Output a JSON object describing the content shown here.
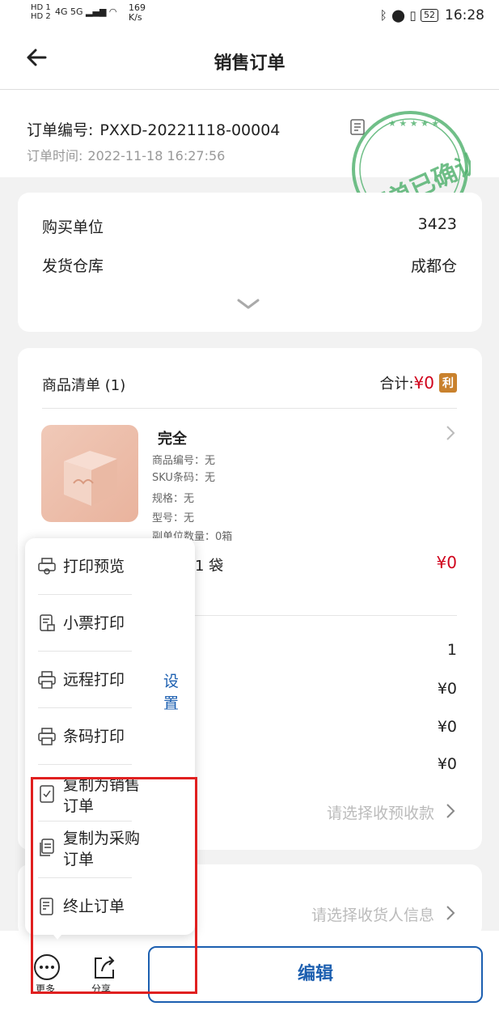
{
  "status_bar": {
    "hd1": "HD 1",
    "hd2": "HD 2",
    "signal": "4G 5G",
    "speed_value": "169",
    "speed_unit": "K/s",
    "battery": "52",
    "time": "16:28"
  },
  "header": {
    "title": "销售订单"
  },
  "order": {
    "number_label": "订单编号:",
    "number": "PXXD-20221118-00004",
    "time_label": "订单时间:",
    "time": "2022-11-18 16:27:56",
    "stamp_text": "订单已确认"
  },
  "basic": {
    "buyer_label": "购买单位",
    "buyer_value": "3423",
    "warehouse_label": "发货仓库",
    "warehouse_value": "成都仓"
  },
  "goods": {
    "list_label": "商品清单 (1)",
    "total_label": "合计:",
    "total_value": "¥0",
    "profit_badge": "利",
    "product": {
      "name": "完全",
      "code": "商品编号：无",
      "sku": "SKU条码：无",
      "spec": "规格：无",
      "model": "型号：无",
      "sub_qty": "副单位数量：0箱",
      "qty": "1 袋",
      "price": "¥0"
    },
    "summary_values": [
      "1",
      "¥0",
      "¥0",
      "¥0"
    ],
    "payment_placeholder": "请选择收预收款"
  },
  "receiver": {
    "placeholder": "请选择收货人信息"
  },
  "menu": {
    "items": [
      {
        "label": "打印预览"
      },
      {
        "label": "小票打印"
      },
      {
        "label": "远程打印"
      },
      {
        "label": "条码打印"
      },
      {
        "label": "复制为销售订单"
      },
      {
        "label": "复制为采购订单"
      },
      {
        "label": "终止订单"
      }
    ],
    "setting_label": "设置"
  },
  "bottom_bar": {
    "more_label": "更多",
    "share_label": "分享",
    "edit_label": "编辑"
  },
  "colors": {
    "accent": "#1c5fb0",
    "price_red": "#d0021b",
    "stamp_green": "#4caf6a",
    "highlight_red": "#e02020"
  }
}
